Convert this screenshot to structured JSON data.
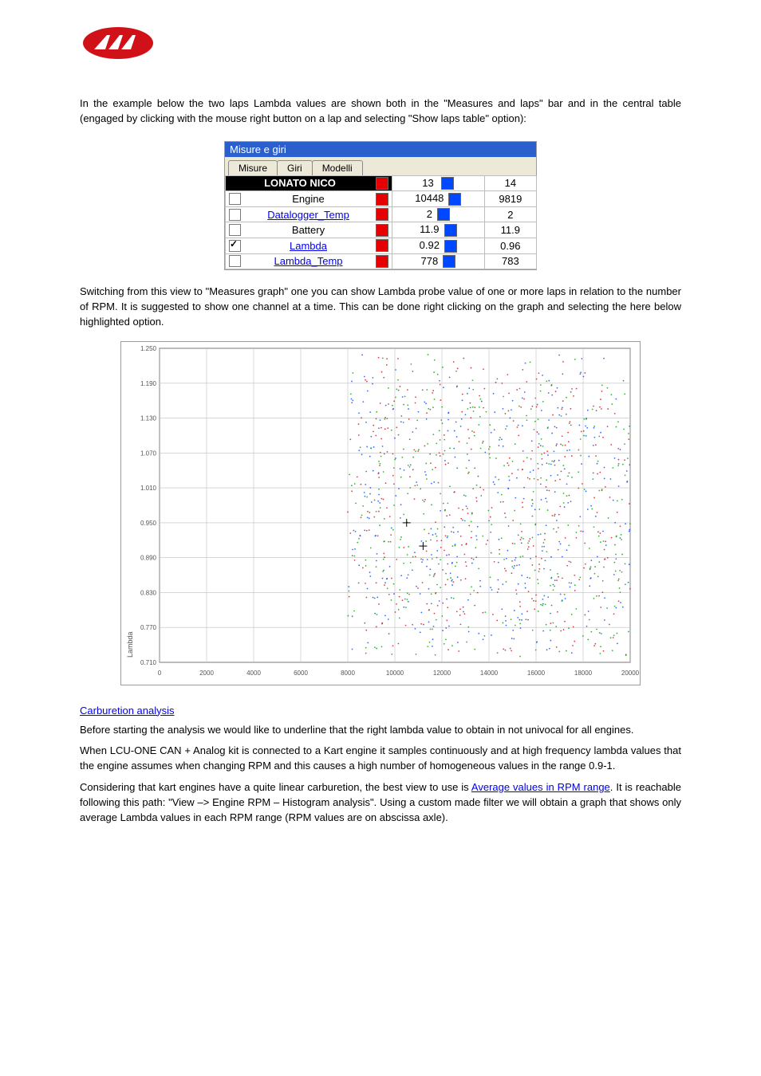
{
  "intro1": "In the example below the two laps Lambda values are shown both in the \"Measures and laps\" bar and in the central table (engaged by clicking with the mouse right button on a lap and selecting \"Show laps table\" option):",
  "intro2": "Switching from this view to \"Measures graph\" one you can show Lambda probe value of one or more laps in relation to the number of RPM. It is suggested to show one channel at a time. This can be done right clicking on the graph and selecting the here below highlighted option.",
  "panel": {
    "title": "Misure e giri",
    "tabs": {
      "t1": "Misure",
      "t2": "Giri",
      "t3": "Modelli"
    },
    "header": {
      "label": "LONATO NICO",
      "c1": "13",
      "c2": "14"
    },
    "rows": [
      {
        "name": "Engine",
        "v1": "10448",
        "v2": "9819",
        "checked": false,
        "link": false
      },
      {
        "name": "Datalogger_Temp",
        "v1": "2",
        "v2": "2",
        "checked": false,
        "link": true
      },
      {
        "name": "Battery",
        "v1": "11.9",
        "v2": "11.9",
        "checked": false,
        "link": false
      },
      {
        "name": "Lambda",
        "v1": "0.92",
        "v2": "0.96",
        "checked": true,
        "link": true
      },
      {
        "name": "Lambda_Temp",
        "v1": "778",
        "v2": "783",
        "checked": false,
        "link": true
      }
    ]
  },
  "chart_data": {
    "type": "scatter",
    "ylabel": "Lambda",
    "ylim": [
      0.71,
      1.25
    ],
    "yticks": [
      "1.250",
      "1.190",
      "1.130",
      "1.070",
      "1.010",
      "0.950",
      "0.890",
      "0.830",
      "0.770",
      "0.710"
    ],
    "xlim": [
      0,
      20000
    ],
    "xticks": [
      "0",
      "2000",
      "4000",
      "6000",
      "8000",
      "10000",
      "12000",
      "14000",
      "16000",
      "18000",
      "20000"
    ],
    "note": "Dense scatter cloud of Lambda vs RPM, three colour traces (red, blue, green) roughly between 8000–20000 RPM and 0.71–1.25 Lambda; values not individually readable."
  },
  "section": {
    "head": "Carburetion analysis",
    "p1": "Before starting the analysis we would like to underline that the right lambda value to obtain in not univocal for all engines.",
    "p2": "When LCU-ONE CAN + Analog kit is connected to a Kart engine it samples continuously and at high frequency lambda values that the engine assumes when changing RPM and this causes a high number of homogeneous values in the range 0.9-1.",
    "p3_part1": "Considering that kart engines have a quite linear carburetion, the best view to use is ",
    "p3_link": "Average values in RPM range",
    "p3_part2": ". It is reachable following this path: \"View –> Engine RPM – Histogram analysis\". Using a custom made filter we will obtain a graph that shows only average Lambda values in each RPM range (RPM values are on abscissa axle)."
  }
}
